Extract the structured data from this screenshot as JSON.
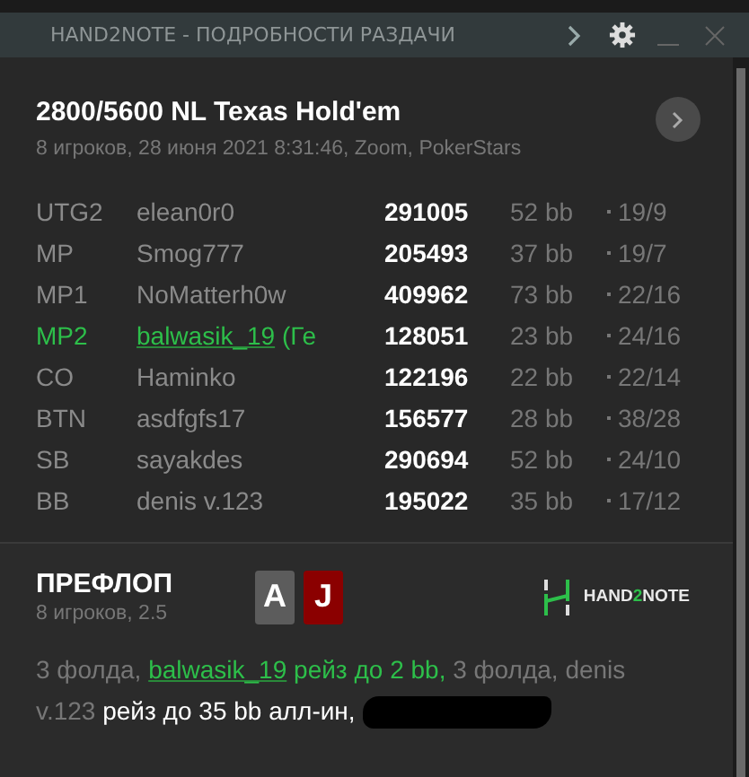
{
  "window": {
    "title": "HAND2NOTE - ПОДРОБНОСТИ РАЗДАЧИ"
  },
  "hand": {
    "title": "2800/5600 NL Texas Hold'em",
    "subtitle": "8 игроков, 28 июня 2021 8:31:46, Zoom, PokerStars"
  },
  "players": [
    {
      "position": "UTG2",
      "name": "elean0r0",
      "stack": "291005",
      "bb": "52 bb",
      "stats": "19/9",
      "hero": false
    },
    {
      "position": "MP",
      "name": "Smog777",
      "stack": "205493",
      "bb": "37 bb",
      "stats": "19/7",
      "hero": false
    },
    {
      "position": "MP1",
      "name": "NoMatterh0w",
      "stack": "409962",
      "bb": "73 bb",
      "stats": "22/16",
      "hero": false
    },
    {
      "position": "MP2",
      "name": "balwasik_19",
      "note": "(Ге",
      "stack": "128051",
      "bb": "23 bb",
      "stats": "24/16",
      "hero": true
    },
    {
      "position": "CO",
      "name": "Haminko",
      "stack": "122196",
      "bb": "22 bb",
      "stats": "22/14",
      "hero": false
    },
    {
      "position": "BTN",
      "name": "asdfgfs17",
      "stack": "156577",
      "bb": "28 bb",
      "stats": "38/28",
      "hero": false
    },
    {
      "position": "SB",
      "name": "sayakdes",
      "stack": "290694",
      "bb": "52 bb",
      "stats": "24/10",
      "hero": false
    },
    {
      "position": "BB",
      "name": "denis v.123",
      "stack": "195022",
      "bb": "35 bb",
      "stats": "17/12",
      "hero": false
    }
  ],
  "street": {
    "title": "ПРЕФЛОП",
    "subtitle": "8 игроков, 2.5",
    "cards": [
      {
        "rank": "A",
        "color": "#5c5c5c"
      },
      {
        "rank": "J",
        "color": "#8b0000"
      }
    ],
    "logo": {
      "prefix": "HAND",
      "digit": "2",
      "suffix": "NOTE"
    },
    "actions": [
      {
        "kind": "fold",
        "text": "3 фолда, "
      },
      {
        "kind": "hero-link",
        "text": "balwasik_19"
      },
      {
        "kind": "hero",
        "text": " рейз до 2 bb,"
      },
      {
        "kind": "fold",
        "text": " 3 фолда, "
      },
      {
        "kind": "player",
        "text": "denis v.123"
      },
      {
        "kind": "bet",
        "text": " рейз до 35 bb алл-ин,"
      }
    ]
  }
}
